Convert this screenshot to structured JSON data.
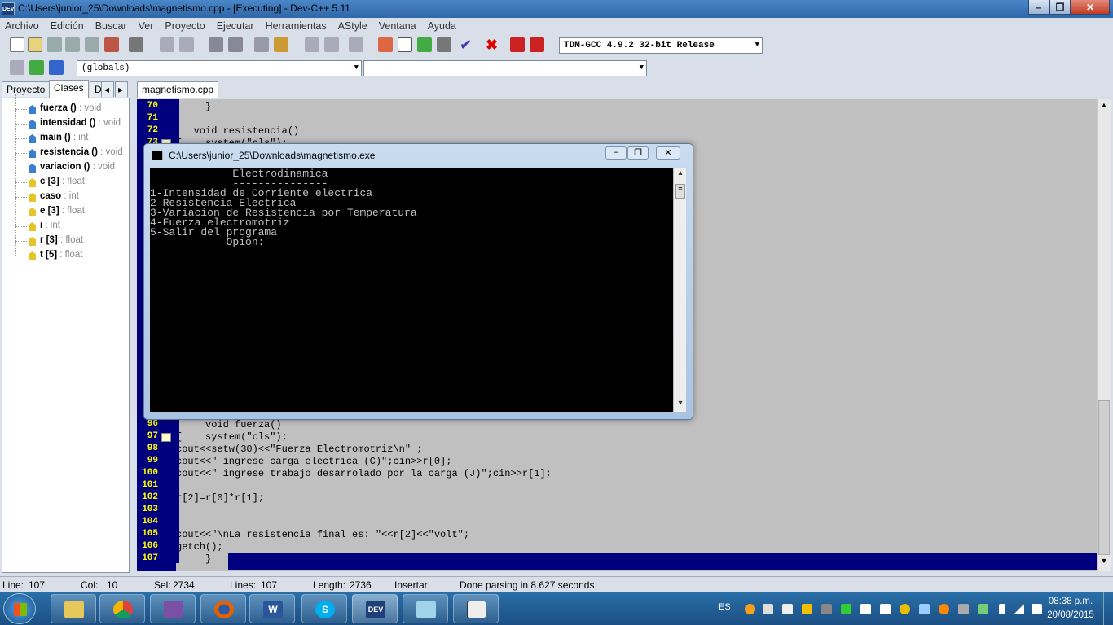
{
  "window": {
    "title": "C:\\Users\\junior_25\\Downloads\\magnetismo.cpp - [Executing] - Dev-C++ 5.11",
    "app_icon": "DEV",
    "controls": {
      "minimize": "–",
      "maximize": "❐",
      "close": "✕"
    }
  },
  "menu": [
    "Archivo",
    "Edición",
    "Buscar",
    "Ver",
    "Proyecto",
    "Ejecutar",
    "Herramientas",
    "AStyle",
    "Ventana",
    "Ayuda"
  ],
  "toolbar": {
    "compiler": "TDM-GCC 4.9.2 32-bit Release",
    "scope": "(globals)",
    "member": ""
  },
  "left_panel": {
    "tabs": [
      "Proyecto",
      "Clases",
      "D"
    ],
    "tab_nav": {
      "prev": "◂",
      "next": "▸"
    },
    "items": [
      {
        "name": "fuerza",
        "sig": " () ",
        "type": ": void",
        "kind": "func"
      },
      {
        "name": "intensidad",
        "sig": " () ",
        "type": ": void",
        "kind": "func"
      },
      {
        "name": "main",
        "sig": " () ",
        "type": ": int",
        "kind": "func"
      },
      {
        "name": "resistencia",
        "sig": " () ",
        "type": ": void",
        "kind": "func"
      },
      {
        "name": "variacion",
        "sig": " () ",
        "type": ": void",
        "kind": "func"
      },
      {
        "name": "c",
        "sig": " [3] ",
        "type": ": float",
        "kind": "var"
      },
      {
        "name": "caso",
        "sig": " ",
        "type": ": int",
        "kind": "var"
      },
      {
        "name": "e",
        "sig": " [3] ",
        "type": ": float",
        "kind": "var"
      },
      {
        "name": "i",
        "sig": " ",
        "type": ": int",
        "kind": "var"
      },
      {
        "name": "r",
        "sig": " [3] ",
        "type": ": float",
        "kind": "var"
      },
      {
        "name": "t",
        "sig": " [5] ",
        "type": ": float",
        "kind": "var"
      }
    ]
  },
  "editor": {
    "tab": "magnetismo.cpp",
    "lines_top": [
      {
        "n": "70",
        "text": "     }"
      },
      {
        "n": "71",
        "text": ""
      },
      {
        "n": "72",
        "text": "   void resistencia()"
      },
      {
        "n": "73",
        "text": "{    system(\"cls\");"
      }
    ],
    "lines_bottom": [
      {
        "n": "96",
        "text": "     void fuerza()"
      },
      {
        "n": "97",
        "text": "{    system(\"cls\");"
      },
      {
        "n": "98",
        "text": "cout<<setw(30)<<\"Fuerza Electromotriz\\n\" ;"
      },
      {
        "n": "99",
        "text": "cout<<\" ingrese carga electrica (C)\";cin>>r[0];"
      },
      {
        "n": "100",
        "text": "cout<<\" ingrese trabajo desarrolado por la carga (J)\";cin>>r[1];"
      },
      {
        "n": "101",
        "text": ""
      },
      {
        "n": "102",
        "text": "r[2]=r[0]*r[1];"
      },
      {
        "n": "103",
        "text": ""
      },
      {
        "n": "104",
        "text": ""
      },
      {
        "n": "105",
        "text": "cout<<\"\\nLa resistencia final es: \"<<r[2]<<\"volt\";"
      },
      {
        "n": "106",
        "text": "getch();"
      },
      {
        "n": "107",
        "text": "     }"
      }
    ]
  },
  "console": {
    "title": "C:\\Users\\junior_25\\Downloads\\magnetismo.exe",
    "lines": [
      "             Electrodinamica",
      "             ---------------",
      "1-Intensidad de Corriente electrica",
      "2-Resistencia Electrica",
      "3-Variacion de Resistencia por Temperatura",
      "4-Fuerza electromotriz",
      "5-Salir del programa",
      "            Opion:"
    ],
    "scroll": {
      "up": "▴",
      "down": "▾",
      "grip": "≡"
    }
  },
  "status": {
    "line_label": "Line:",
    "line": "107",
    "col_label": "Col:",
    "col": "10",
    "sel_label": "Sel:",
    "sel": "2734",
    "lines_label": "Lines:",
    "lines": "107",
    "length_label": "Length:",
    "length": "2736",
    "mode": "Insertar",
    "message": "Done parsing in 8.627 seconds"
  },
  "taskbar": {
    "apps": [
      "explorer",
      "chrome",
      "snipping-tool",
      "firefox",
      "word",
      "skype",
      "devcpp",
      "notepad",
      "media"
    ],
    "devcpp_label": "DEV",
    "word_label": "W",
    "skype_label": "S",
    "language": "ES",
    "time": "08:38 p.m.",
    "date": "20/08/2015"
  }
}
